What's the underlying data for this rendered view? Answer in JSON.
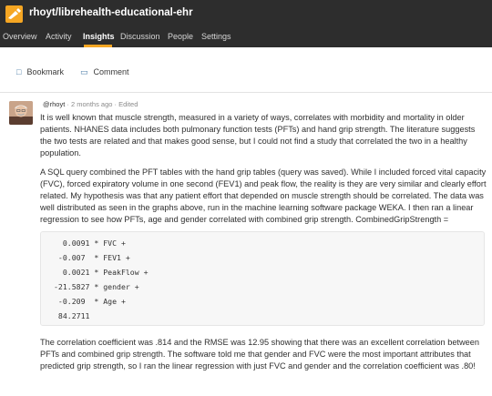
{
  "header": {
    "repo_title": "rhoyt/librehealth-educational-ehr",
    "nav": [
      "Overview",
      "Activity",
      "Insights",
      "Discussion",
      "People",
      "Settings"
    ],
    "active_nav": "Insights",
    "brand_color": "#f5a623",
    "logo_icon": "pen-icon"
  },
  "actions": {
    "bookmark_label": "Bookmark",
    "bookmark_icon": "bookmark-icon",
    "comment_label": "Comment",
    "comment_icon": "comment-icon"
  },
  "post": {
    "author": "@rhoyt",
    "time": "2 months ago",
    "edited": "Edited",
    "separator": "·",
    "para1": "It is well known that muscle strength, measured in a variety of ways, correlates with morbidity and mortality in older patients. NHANES data includes both pulmonary function tests (PFTs) and hand grip strength. The literature suggests the two tests are related and that makes good sense, but I could not find a study that correlated the two in a healthy population.",
    "para2": "A SQL query combined the PFT tables with the hand grip tables (query was saved). While I included forced vital capacity (FVC), forced expiratory volume in one second (FEV1) and peak flow, the reality is they are very similar and clearly effort related. My hypothesis was that any patient effort that depended on muscle strength should be correlated. The data was well distributed as seen in the graphs above, run in the machine learning software package WEKA. I then ran a linear regression to see how PFTs, age and gender correlated with combined grip strength. CombinedGripStrength =",
    "code": [
      "  0.0091 * FVC +",
      " -0.007  * FEV1 +",
      "  0.0021 * PeakFlow +",
      "-21.5827 * gender +",
      " -0.209  * Age +",
      " 84.2711"
    ],
    "para3": "The correlation coefficient was .814 and the RMSE was 12.95 showing that there was an excellent correlation between PFTs and combined grip strength. The software told me that gender and FVC were the most important attributes that predicted grip strength, so I ran the linear regression with just FVC and gender and the correlation coefficient was .80!"
  }
}
